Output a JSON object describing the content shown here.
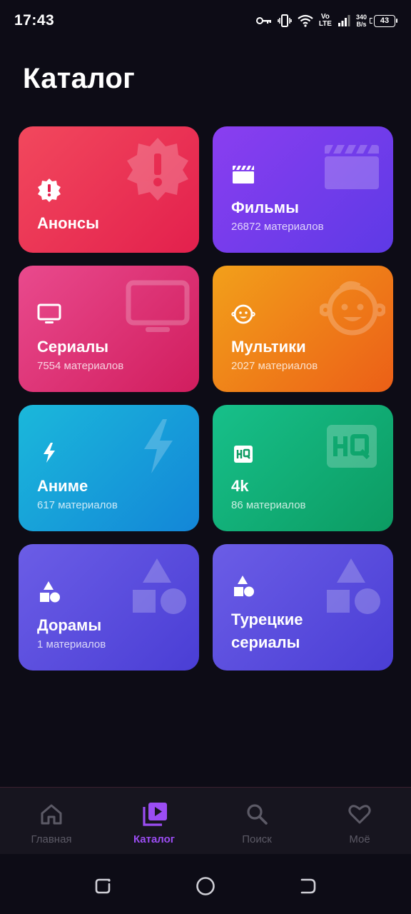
{
  "status": {
    "time": "17:43",
    "volte_top": "Vo",
    "volte_bottom": "LTE",
    "speed_value": "340",
    "speed_unit": "B/s",
    "battery": "43"
  },
  "page": {
    "title": "Каталог"
  },
  "cards": [
    {
      "label": "Анонсы",
      "count": "",
      "icon": "alert-badge-icon"
    },
    {
      "label": "Фильмы",
      "count": "26872 материалов",
      "icon": "clapperboard-icon"
    },
    {
      "label": "Сериалы",
      "count": "7554 материалов",
      "icon": "tv-icon"
    },
    {
      "label": "Мультики",
      "count": "2027 материалов",
      "icon": "child-face-icon"
    },
    {
      "label": "Аниме",
      "count": "617 материалов",
      "icon": "lightning-icon"
    },
    {
      "label": "4k",
      "count": "86 материалов",
      "icon": "hq-icon"
    },
    {
      "label": "Дорамы",
      "count": "1 материалов",
      "icon": "shapes-icon"
    },
    {
      "label_line1": "Турецкие",
      "label_line2": "сериалы",
      "count": "",
      "icon": "shapes-icon"
    }
  ],
  "nav": {
    "items": [
      {
        "label": "Главная",
        "icon": "home-icon",
        "active": false
      },
      {
        "label": "Каталог",
        "icon": "catalog-icon",
        "active": true
      },
      {
        "label": "Поиск",
        "icon": "search-icon",
        "active": false
      },
      {
        "label": "Моё",
        "icon": "heart-icon",
        "active": false
      }
    ],
    "active_color": "#9b4df3",
    "inactive_color": "#5c5a66"
  }
}
